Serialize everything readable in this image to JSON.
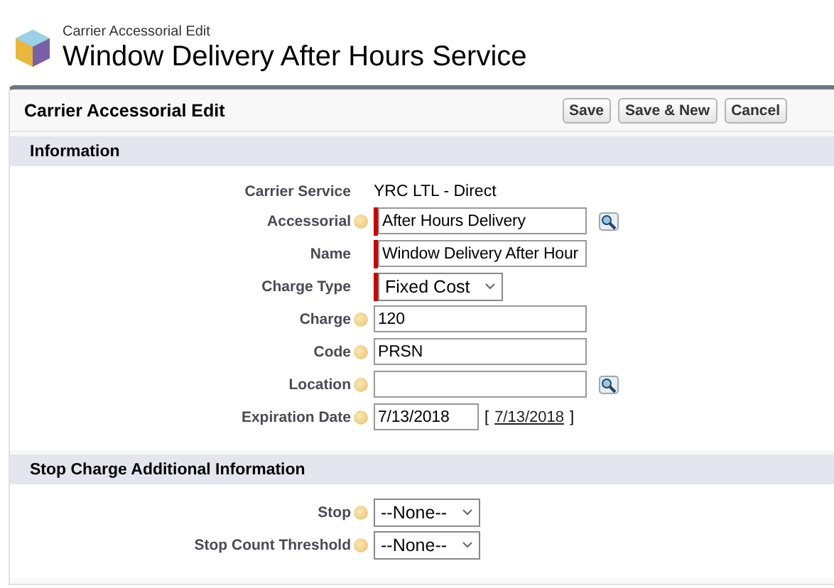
{
  "header": {
    "subtitle": "Carrier Accessorial Edit",
    "title": "Window Delivery After Hours Service"
  },
  "panel": {
    "title": "Carrier Accessorial Edit",
    "buttons": [
      "Save",
      "Save & New",
      "Cancel"
    ]
  },
  "sections": [
    {
      "title": "Information",
      "fields": [
        {
          "label": "Carrier Service",
          "kind": "text",
          "value": "YRC LTL - Direct",
          "help": false,
          "required": false,
          "lookup": false
        },
        {
          "label": "Accessorial",
          "kind": "input",
          "value": "After Hours Delivery",
          "help": true,
          "required": true,
          "lookup": true
        },
        {
          "label": "Name",
          "kind": "input",
          "value": "Window Delivery After Hour",
          "help": false,
          "required": true,
          "lookup": false
        },
        {
          "label": "Charge Type",
          "kind": "select",
          "value": "Fixed Cost",
          "help": false,
          "required": true,
          "lookup": false
        },
        {
          "label": "Charge",
          "kind": "input",
          "value": "120",
          "help": true,
          "required": false,
          "lookup": false
        },
        {
          "label": "Code",
          "kind": "input",
          "value": "PRSN",
          "help": true,
          "required": false,
          "lookup": false
        },
        {
          "label": "Location",
          "kind": "input",
          "help": true,
          "required": false,
          "lookup": true
        },
        {
          "label": "Expiration Date",
          "kind": "date",
          "value": "7/13/2018",
          "today": "7/13/2018",
          "open_bracket": "[",
          "close_bracket": "]",
          "help": true,
          "required": false,
          "lookup": false
        }
      ]
    },
    {
      "title": "Stop Charge Additional Information",
      "fields": [
        {
          "label": "Stop",
          "kind": "select",
          "value": "--None--",
          "help": true,
          "required": false,
          "lookup": false
        },
        {
          "label": "Stop Count Threshold",
          "kind": "select",
          "value": "--None--",
          "help": true,
          "required": false,
          "lookup": false
        }
      ]
    }
  ]
}
